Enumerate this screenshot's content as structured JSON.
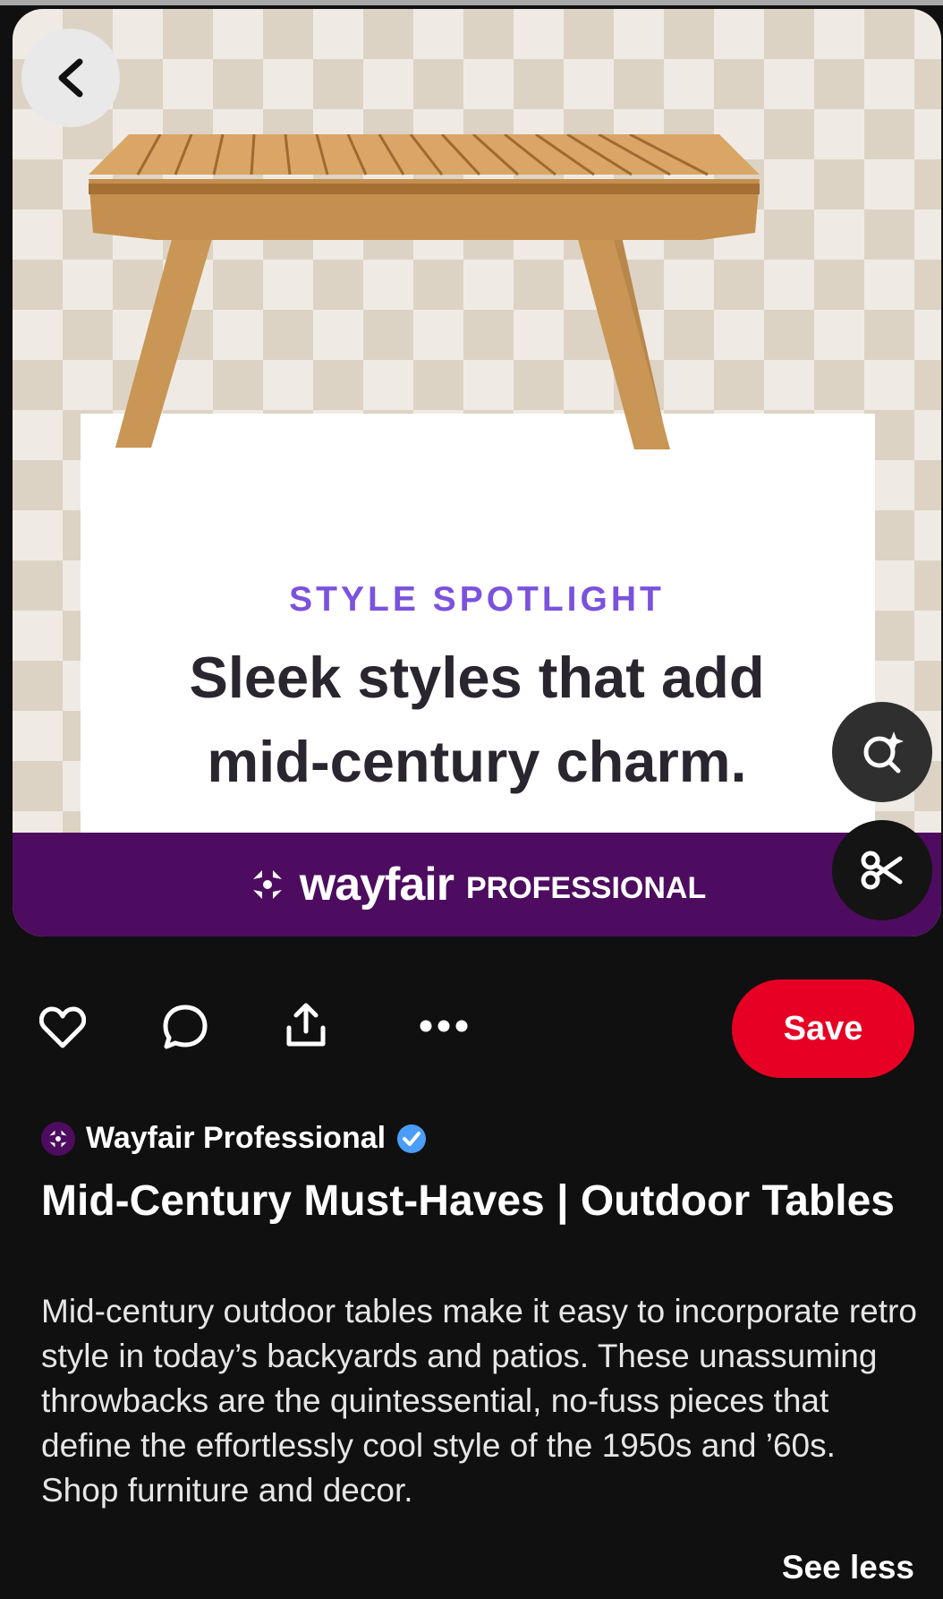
{
  "pin": {
    "image": {
      "kicker": "STYLE SPOTLIGHT",
      "headline_line1": "Sleek styles that add",
      "headline_line2": "mid-century charm.",
      "brand_logo": "wayfair",
      "brand_suffix": "PROFESSIONAL"
    },
    "creator": {
      "name": "Wayfair Professional",
      "verified": true
    },
    "title": "Mid-Century Must-Haves | Outdoor Tables",
    "description": "Mid-century outdoor tables make it easy to incorporate retro style in today’s backyards and patios. These unassuming throwbacks are the quintessential, no-fuss pieces that define the effortlessly cool style of the 1950s and ’60s. Shop furniture and decor.",
    "see_less": "See less"
  },
  "actions": {
    "save_label": "Save",
    "icons": [
      "heart-icon",
      "comment-icon",
      "share-icon",
      "more-icon"
    ]
  },
  "floating": [
    "visual-search-icon",
    "scissors-icon"
  ],
  "colors": {
    "save": "#e60023",
    "brand": "#4d0c5f",
    "kicker": "#7b52dd",
    "verified": "#4a9df8"
  }
}
